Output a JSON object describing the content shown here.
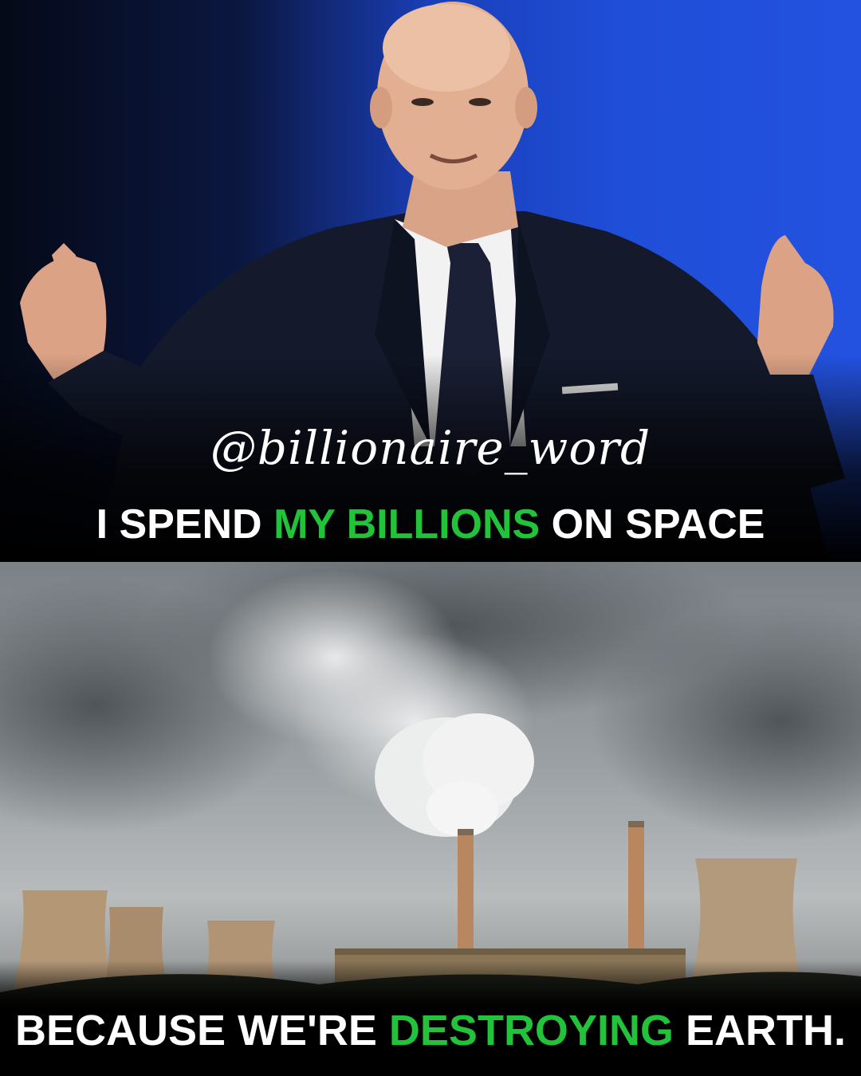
{
  "watermark": "@billionaire_word",
  "caption_top": {
    "before": "I SPEND ",
    "highlight": "MY BILLIONS",
    "after": " ON SPACE"
  },
  "caption_bottom": {
    "before": "BECAUSE WE'RE ",
    "highlight": "DESTROYING",
    "after": " EARTH."
  },
  "colors": {
    "highlight": "#22c23a",
    "text": "#ffffff",
    "background": "#000000",
    "stage_blue": "#1f4ed8"
  },
  "images": {
    "top": "man-in-suit-gesturing-photo",
    "bottom": "power-plant-smokestacks-photo"
  }
}
